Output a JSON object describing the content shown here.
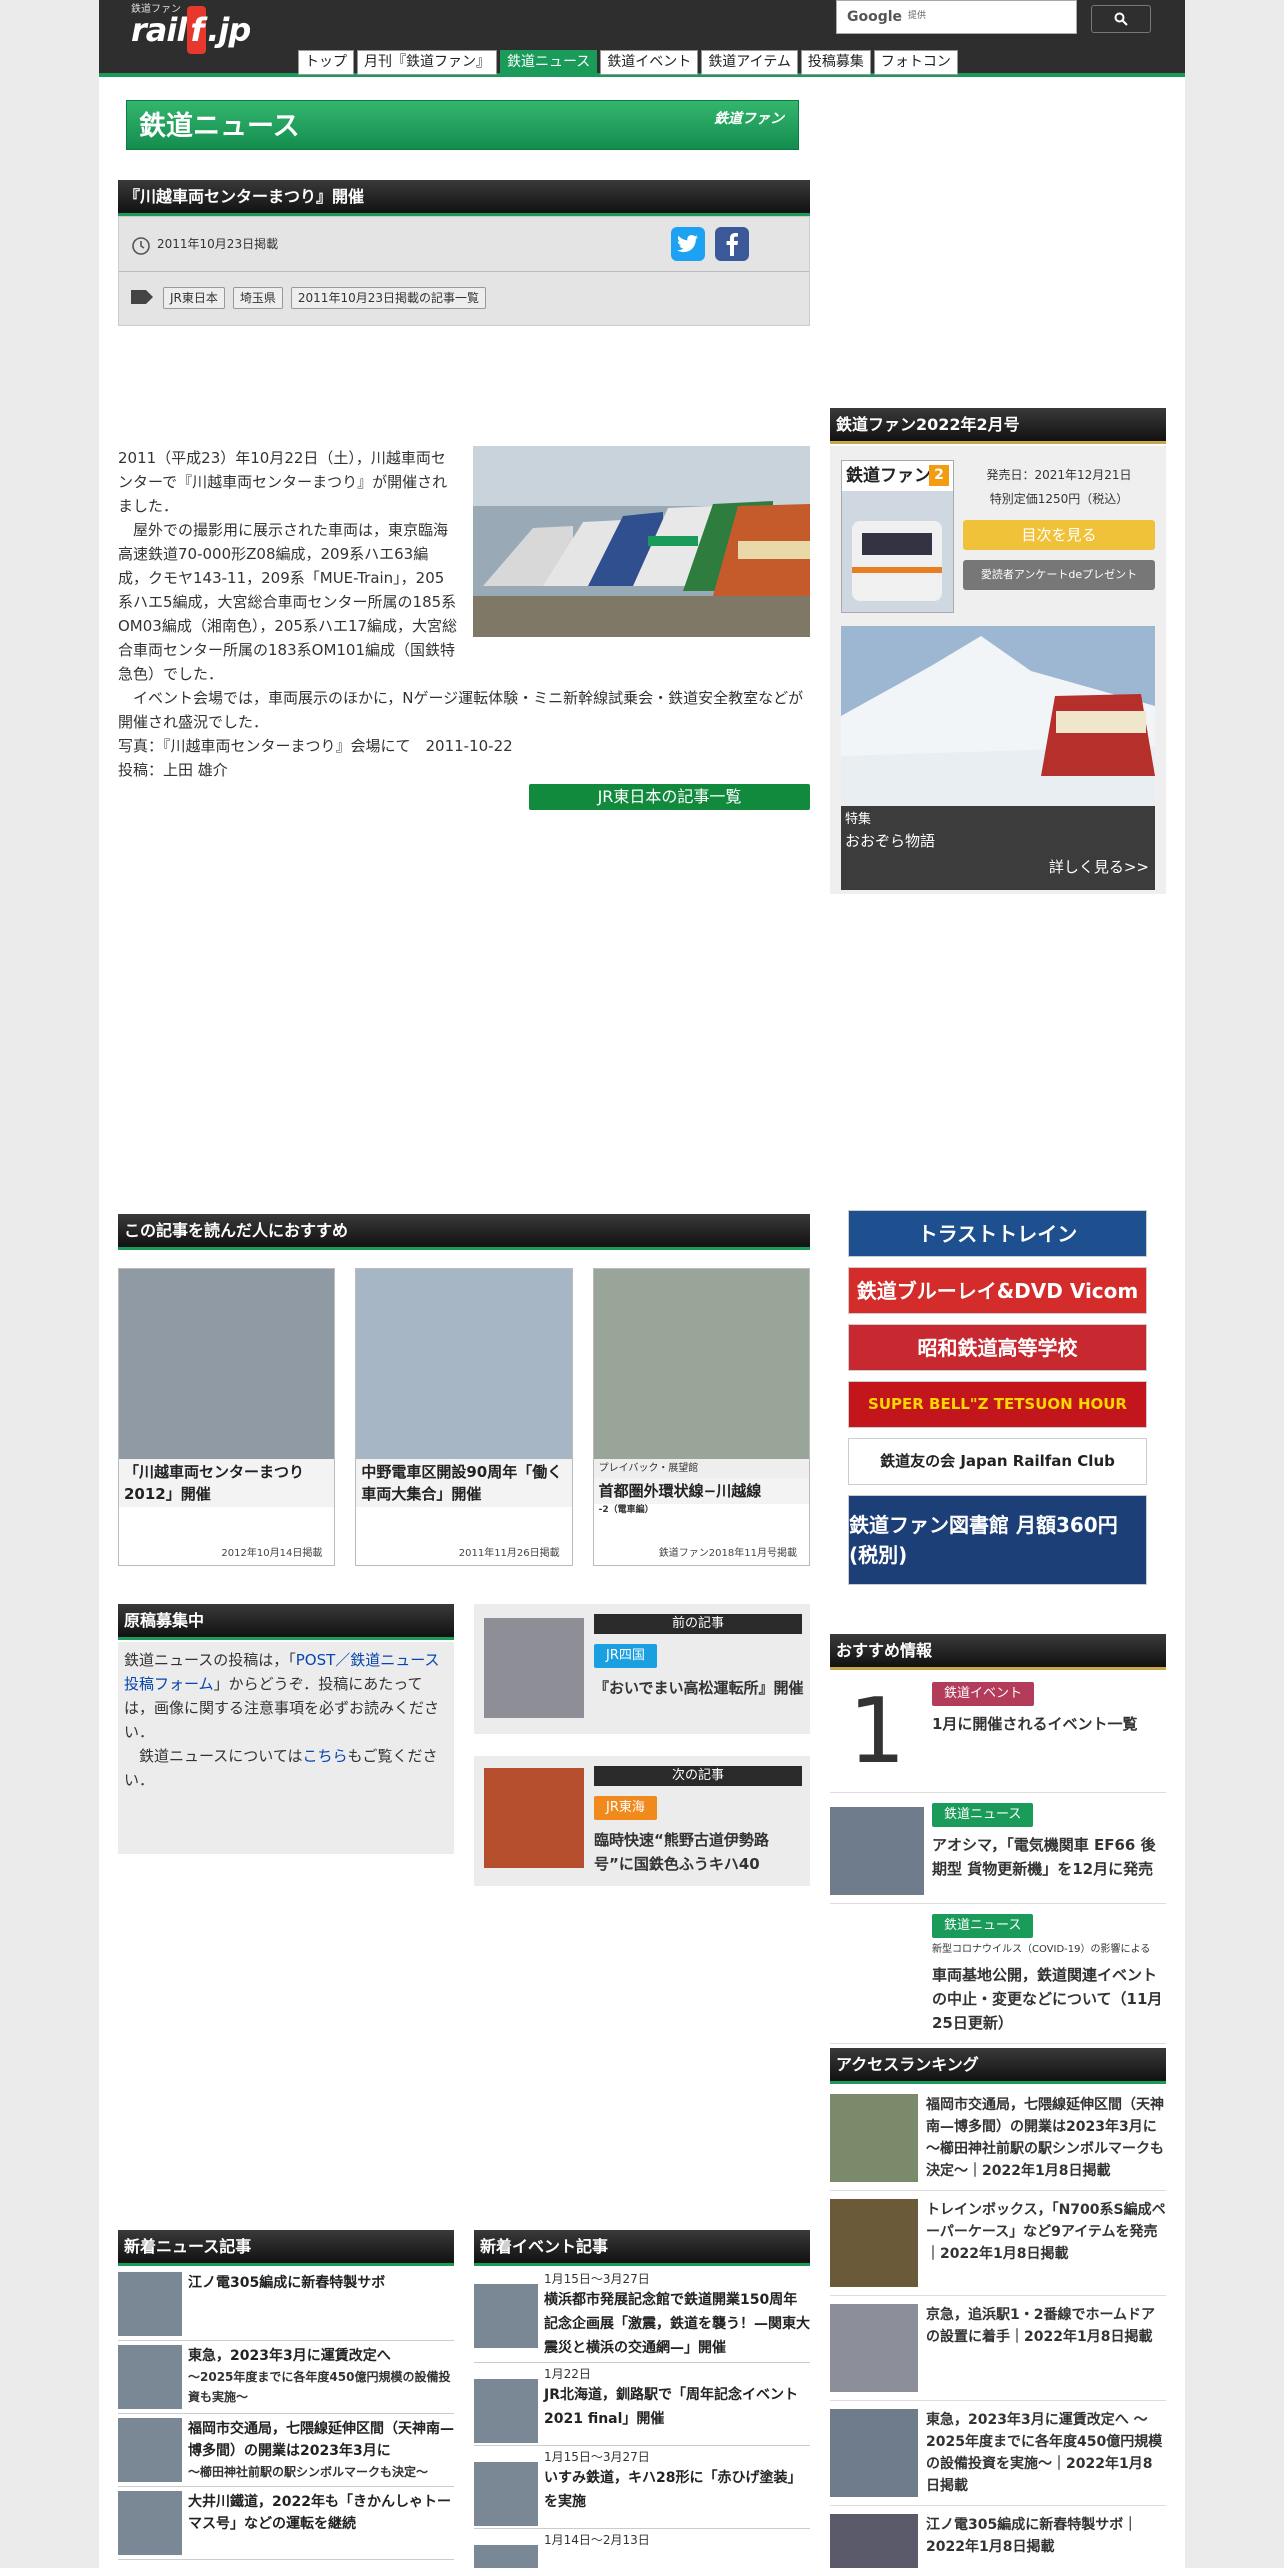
{
  "header": {
    "logo_small": "鉄道ファン",
    "logo_pre": "rail",
    "logo_f": "f",
    "logo_post": ".jp",
    "search_brand": "Google",
    "search_placeholder": "提供",
    "nav": [
      "トップ",
      "月刊『鉄道ファン』",
      "鉄道ニュース",
      "鉄道イベント",
      "鉄道アイテム",
      "投稿募集",
      "フォトコン"
    ],
    "nav_active": 2
  },
  "banner": {
    "title": "鉄道ニュース",
    "brand": "鉄道ファン"
  },
  "article": {
    "title": "『川越車両センターまつり』開催",
    "date": "2011年10月23日掲載",
    "tags": [
      "JR東日本",
      "埼玉県",
      "2011年10月23日掲載の記事一覧"
    ],
    "p1": "2011（平成23）年10月22日（土），川越車両センターで『川越車両センターまつり』が開催されました．",
    "p2": "屋外での撮影用に展示された車両は，東京臨海高速鉄道70-000形Z08編成，209系ハエ63編成，クモヤ143-11，209系「MUE-Train」，205系ハエ5編成，大宮総合車両センター所属の185系OM03編成（湘南色），205系ハエ17編成，大宮総合車両センター所属の183系OM101編成（国鉄特急色）でした．",
    "p3": "イベント会場では，車両展示のほかに，Nゲージ運転体験・ミニ新幹線試乗会・鉄道安全教室などが開催され盛況でした．",
    "caption": "写真：『川越車両センターまつり』会場にて　2011-10-22",
    "author": "投稿：上田 雄介",
    "list_button": "JR東日本の記事一覧"
  },
  "magazine": {
    "header": "鉄道ファン2022年2月号",
    "release": "発売日：2021年12月21日",
    "price": "特別定価1250円（税込）",
    "toc_button": "目次を見る",
    "survey_button": "愛読者アンケートdeプレゼント",
    "cover_title": "鉄道ファン",
    "cover_num": "2",
    "feature_label": "特集",
    "feature_title": "おおぞら物語",
    "more": "詳しく見る>>"
  },
  "ads": [
    "トラストトレイン",
    "鉄道ブルーレイ&DVD  Vicom",
    "昭和鉄道高等学校",
    "SUPER BELL\"Z TETSUON HOUR",
    "鉄道友の会 Japan Railfan Club",
    "鉄道ファン図書館 月額360円(税別)"
  ],
  "recommend": {
    "header": "この記事を読んだ人におすすめ",
    "cards": [
      {
        "title": "「川越車両センターまつり2012」開催",
        "sub": "",
        "date": "2012年10月14日掲載"
      },
      {
        "title": "中野電車区開設90周年「働く車両大集合」開催",
        "sub": "",
        "date": "2011年11月26日掲載"
      },
      {
        "title": "首都圏外環状線−川越線",
        "sub": "-2（電車編）",
        "label": "プレイバック・展望館",
        "date": "鉄道ファン2018年11月号掲載"
      }
    ]
  },
  "submit": {
    "header": "原稿募集中",
    "t1": "鉄道ニュースの投稿は，「",
    "link1": "POST／鉄道ニュース投稿フォーム",
    "t2": "」からどうぞ．投稿にあたっては，画像に関する注意事項を必ずお読みください．",
    "t3": "鉄道ニュースについては",
    "link2": "こちら",
    "t4": "もご覧ください．"
  },
  "prevnext": {
    "prev": {
      "label": "前の記事",
      "tag": "JR四国",
      "title": "『おいでまい高松運転所』開催"
    },
    "next": {
      "label": "次の記事",
      "tag": "JR東海",
      "title": "臨時快速“熊野古道伊勢路号”に国鉄色ふうキハ40"
    }
  },
  "osusume": {
    "header": "おすすめ情報",
    "items": [
      {
        "big": "1",
        "tag": "鉄道イベント",
        "title": "1月に開催されるイベント一覧",
        "sub": ""
      },
      {
        "tag": "鉄道ニュース",
        "title": "アオシマ，「電気機関車 EF66 後期型 貨物更新機」を12月に発売",
        "sub": ""
      },
      {
        "tag": "鉄道ニュース",
        "sub": "新型コロナウイルス（COVID-19）の影響による",
        "title": "車両基地公開，鉄道関連イベントの中止・変更などについて（11月25日更新）"
      }
    ]
  },
  "ranking": {
    "header": "アクセスランキング",
    "items": [
      "福岡市交通局，七隈線延伸区間（天神南—博多間）の開業は2023年3月に 〜櫛田神社前駅の駅シンボルマークも決定〜｜2022年1月8日掲載",
      "トレインボックス，「N700系S編成ペーパーケース」など9アイテムを発売｜2022年1月8日掲載",
      "京急，追浜駅1・2番線でホームドアの設置に着手｜2022年1月8日掲載",
      "東急，2023年3月に運賃改定へ 〜2025年度までに各年度450億円規模の設備投資を実施〜｜2022年1月8日掲載",
      "江ノ電305編成に新春特製サボ｜2022年1月8日掲載"
    ]
  },
  "newnews": {
    "header": "新着ニュース記事",
    "items": [
      {
        "title": "江ノ電305編成に新春特製サボ",
        "sub": ""
      },
      {
        "title": "東急，2023年3月に運賃改定へ",
        "sub": "〜2025年度までに各年度450億円規模の設備投資も実施〜"
      },
      {
        "title": "福岡市交通局，七隈線延伸区間（天神南—博多間）の開業は2023年3月に",
        "sub": "〜櫛田神社前駅の駅シンボルマークも決定〜"
      },
      {
        "title": "大井川鐵道，2022年も「きかんしゃトーマス号」などの運転を継続",
        "sub": ""
      }
    ]
  },
  "newevents": {
    "header": "新着イベント記事",
    "items": [
      {
        "date": "1月15日〜3月27日",
        "title": "横浜都市発展記念館で鉄道開業150周年記念企画展「激震，鉄道を襲う！—関東大震災と横浜の交通網—」開催"
      },
      {
        "date": "1月22日",
        "title": "JR北海道，釧路駅で「周年記念イベント2021 final」開催"
      },
      {
        "date": "1月15日〜3月27日",
        "title": "いすみ鉄道，キハ28形に「赤ひげ塗装」を実施"
      },
      {
        "date": "1月14日〜2月13日",
        "title": ""
      }
    ]
  }
}
